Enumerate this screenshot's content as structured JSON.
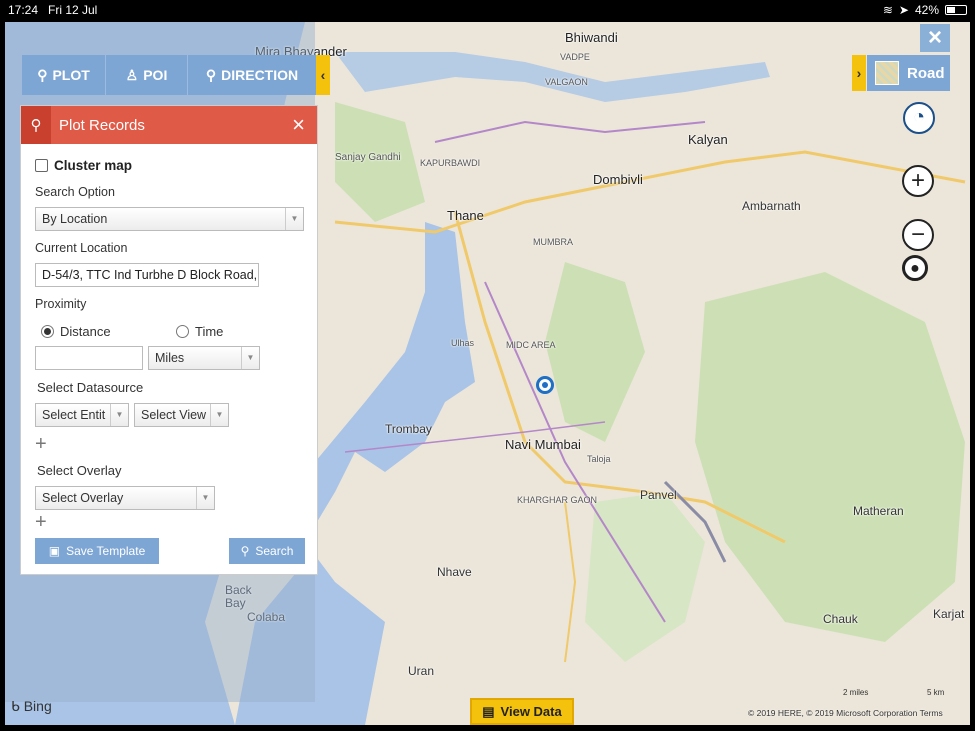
{
  "status": {
    "time": "17:24",
    "date": "Fri 12 Jul",
    "battery": "42%"
  },
  "toolbar": {
    "plot": "PLOT",
    "poi": "POI",
    "direction": "DIRECTION"
  },
  "panel": {
    "title": "Plot Records",
    "cluster_map": "Cluster map",
    "search_option_label": "Search Option",
    "search_option_value": "By Location",
    "current_location_label": "Current Location",
    "current_location_value": "D-54/3, TTC Ind Turbhe D Block Road,",
    "proximity_label": "Proximity",
    "distance_label": "Distance",
    "time_label": "Time",
    "distance_value": "",
    "unit_value": "Miles",
    "select_datasource_label": "Select Datasource",
    "select_entity": "Select Entit",
    "select_view": "Select View",
    "select_overlay_label": "Select Overlay",
    "select_overlay": "Select Overlay",
    "save_template": "Save Template",
    "search": "Search"
  },
  "map": {
    "road_label": "Road",
    "view_data": "View Data",
    "bing": "Bing",
    "copyright": "© 2019 HERE, © 2019 Microsoft Corporation  Terms",
    "scale_miles": "2 miles",
    "scale_km": "5 km",
    "places": {
      "mira": "Mira Bhayander",
      "bhiwandi": "Bhiwandi",
      "kalyan": "Kalyan",
      "dombivli": "Dombivli",
      "thane": "Thane",
      "ambarnath": "Ambarnath",
      "sanjay": "Sanjay Gandhi",
      "trombay": "Trombay",
      "navi": "Navi Mumbai",
      "panvel": "Panvel",
      "taloja": "Taloja",
      "ulhas": "Ulhas",
      "matheran": "Matheran",
      "nhave": "Nhave",
      "uran": "Uran",
      "chauk": "Chauk",
      "karjat": "Karjat",
      "backbay": "Back\nBay",
      "colaba": "Colaba",
      "vadpe": "VADPE",
      "valgaon": "VALGAON",
      "midc": "MIDC AREA",
      "kharghar": "KHARGHAR GAON",
      "mumbra": "MUMBRA",
      "kapurbawdi": "KAPURBAWDI"
    }
  },
  "colors": {
    "accent_blue": "#7ea6d4",
    "header_red": "#e05a48",
    "yellow": "#f4c20d"
  }
}
